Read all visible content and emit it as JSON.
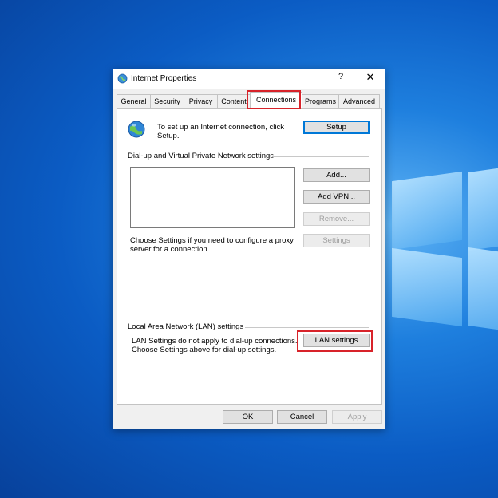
{
  "dialog": {
    "title": "Internet Properties",
    "help_glyph": "?",
    "close_glyph": "✕"
  },
  "tabs": [
    {
      "label": "General"
    },
    {
      "label": "Security"
    },
    {
      "label": "Privacy"
    },
    {
      "label": "Content"
    },
    {
      "label": "Connections",
      "active": true
    },
    {
      "label": "Programs"
    },
    {
      "label": "Advanced"
    }
  ],
  "connections": {
    "setup_text": "To set up an Internet connection, click Setup.",
    "setup_button": "Setup",
    "dialup_group": "Dial-up and Virtual Private Network settings",
    "add_button": "Add...",
    "add_vpn_button": "Add VPN...",
    "remove_button": "Remove...",
    "settings_button": "Settings",
    "proxy_text": "Choose Settings if you need to configure a proxy server for a connection.",
    "lan_group": "Local Area Network (LAN) settings",
    "lan_text_1": "LAN Settings do not apply to dial-up connections.",
    "lan_text_2": "Choose Settings above for dial-up settings.",
    "lan_button": "LAN settings"
  },
  "footer": {
    "ok": "OK",
    "cancel": "Cancel",
    "apply": "Apply"
  },
  "colors": {
    "highlight": "#d8232a",
    "default_button_border": "#0078d7"
  }
}
